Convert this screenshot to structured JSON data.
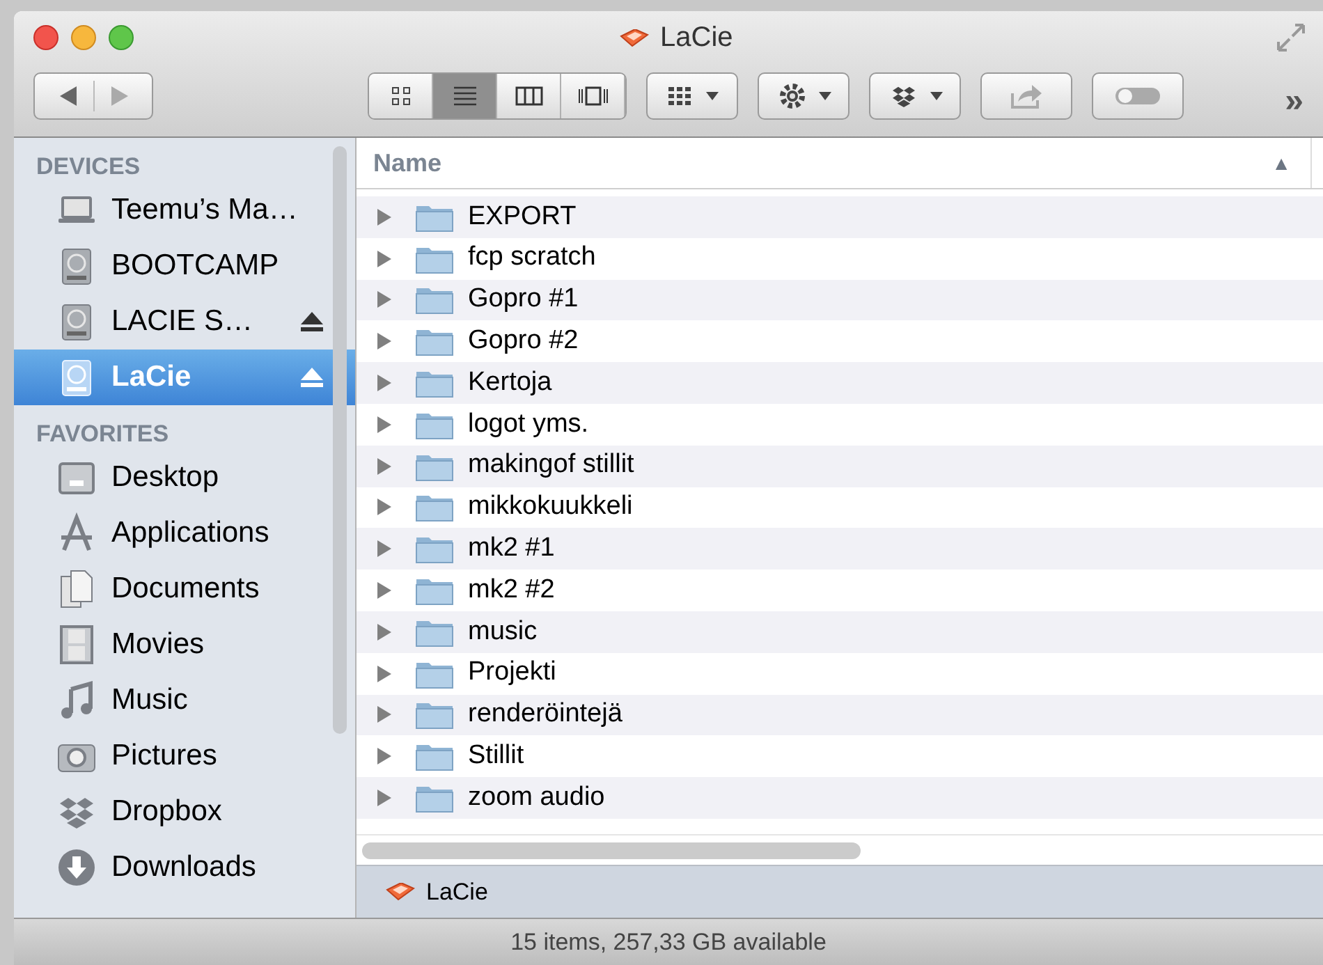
{
  "window": {
    "title": "LaCie"
  },
  "toolbar": {
    "view_buttons": [
      {
        "kind": "icons",
        "selected": false
      },
      {
        "kind": "list",
        "selected": true
      },
      {
        "kind": "columns",
        "selected": false
      },
      {
        "kind": "coverflow",
        "selected": false
      }
    ],
    "more": "»"
  },
  "sidebar": {
    "sections": [
      {
        "heading": "DEVICES",
        "items": [
          {
            "label": "Teemu’s Ma…",
            "kind": "laptop",
            "eject": false,
            "selected": false
          },
          {
            "label": "BOOTCAMP",
            "kind": "disk",
            "eject": false,
            "selected": false
          },
          {
            "label": "LACIE S…",
            "kind": "disk",
            "eject": true,
            "selected": false
          },
          {
            "label": "LaCie",
            "kind": "disk",
            "eject": true,
            "selected": true
          }
        ]
      },
      {
        "heading": "FAVORITES",
        "items": [
          {
            "label": "Desktop",
            "kind": "desktop",
            "eject": false,
            "selected": false
          },
          {
            "label": "Applications",
            "kind": "apps",
            "eject": false,
            "selected": false
          },
          {
            "label": "Documents",
            "kind": "docs",
            "eject": false,
            "selected": false
          },
          {
            "label": "Movies",
            "kind": "movies",
            "eject": false,
            "selected": false
          },
          {
            "label": "Music",
            "kind": "music",
            "eject": false,
            "selected": false
          },
          {
            "label": "Pictures",
            "kind": "pictures",
            "eject": false,
            "selected": false
          },
          {
            "label": "Dropbox",
            "kind": "dropbox",
            "eject": false,
            "selected": false
          },
          {
            "label": "Downloads",
            "kind": "downloads",
            "eject": false,
            "selected": false
          }
        ]
      }
    ]
  },
  "table": {
    "columns": [
      {
        "label": "Name",
        "sort": "▲"
      }
    ],
    "rows": [
      {
        "name": "EXPORT"
      },
      {
        "name": "fcp scratch"
      },
      {
        "name": "Gopro #1"
      },
      {
        "name": "Gopro #2"
      },
      {
        "name": "Kertoja"
      },
      {
        "name": "logot yms."
      },
      {
        "name": "makingof stillit"
      },
      {
        "name": "mikkokuukkeli"
      },
      {
        "name": "mk2 #1"
      },
      {
        "name": "mk2 #2"
      },
      {
        "name": "music"
      },
      {
        "name": "Projekti"
      },
      {
        "name": "renderöintejä"
      },
      {
        "name": "Stillit"
      },
      {
        "name": "zoom audio"
      }
    ]
  },
  "path_bar": {
    "label": "LaCie"
  },
  "status_bar": "15 items, 257,33 GB available"
}
